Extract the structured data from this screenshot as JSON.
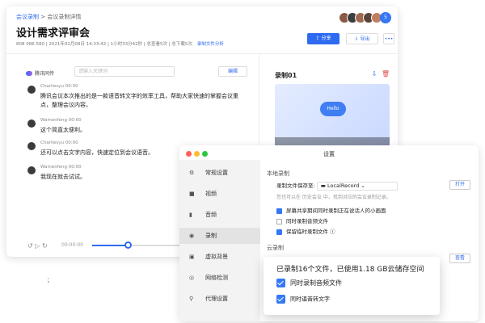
{
  "app": {
    "breadcrumb_root": "会议录制",
    "breadcrumb_sep": " > ",
    "breadcrumb_current": "会议录制详情",
    "title": "设计需求评审会",
    "meta": "808 086 580 | 2021年02月08日 14:33:42 | 1小时33分42秒 | 总查看5次 | 总下载5次",
    "meta_link": "录制文件分析",
    "share_label": "分享",
    "export_label": "导出",
    "more_label": "•••",
    "avatar_more": "5",
    "brand": "腾讯同传",
    "search_placeholder": "请输入关键词",
    "edit_label": "编辑",
    "messages": [
      {
        "name": "Charliesyu 00:00",
        "text": "腾讯会议本次推出的是一款语音转文字的效率工具，帮助大家快速的掌握会议重点，整理会议内容。"
      },
      {
        "name": "Wamenfeng 00:00",
        "text": "这个简直太便利。"
      },
      {
        "name": "Charliesyu 00:00",
        "text": "还可以点击文字内容，快速定位到会议语音。"
      },
      {
        "name": "Wamenfeng 00:00",
        "text": "我现在就去试试。"
      }
    ],
    "player_time": "00:00:00",
    "recording_title": "录制01",
    "video_label": "Hello"
  },
  "settings": {
    "title": "设置",
    "nav": [
      {
        "label": "常规设置",
        "icon": "gear-icon"
      },
      {
        "label": "视频",
        "icon": "video-icon"
      },
      {
        "label": "音频",
        "icon": "audio-icon"
      },
      {
        "label": "录制",
        "icon": "record-icon"
      },
      {
        "label": "虚拟背景",
        "icon": "background-icon"
      },
      {
        "label": "网络检测",
        "icon": "network-icon"
      },
      {
        "label": "代理设置",
        "icon": "proxy-icon"
      }
    ],
    "local_header": "本地录制",
    "save_label": "录制文件保存至:",
    "folder": "LocalRecord",
    "history_note": "您也可以在 历史会议 中，找到对应的会议录制记录。",
    "open_label": "打开",
    "opt1": "屏幕共享期间同时录制正在说话人的小画面",
    "opt2": "同时录制音频文件",
    "opt3": "保留临时录制文件",
    "cloud_header": "云录制",
    "view_label": "查看"
  },
  "popup": {
    "status": "已录制16个文件，已使用1.18 GB云储存空间",
    "opt1": "同时录制音频文件",
    "opt2": "同时语音转文字"
  },
  "stray": "；",
  "colors": {
    "accent": "#2f6bf0",
    "checkbox": "#3478f6"
  }
}
